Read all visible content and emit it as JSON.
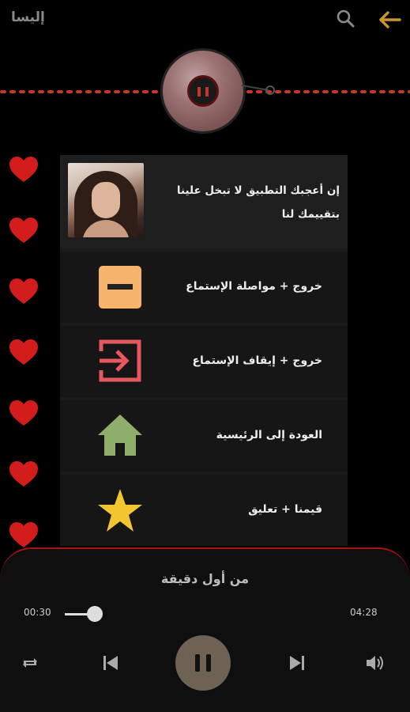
{
  "header": {
    "title": "إليسا",
    "search_icon": "search-icon",
    "back_icon": "back-arrow-icon",
    "accent": "#c9952c"
  },
  "dialog": {
    "rate_message": "إن أعجبك التطبيق لا تبخل علينا بتقييمك لنا",
    "items": [
      {
        "label": "خروج + مواصلة الإستماع",
        "icon": "minus-box-icon",
        "color": "#f5b36b"
      },
      {
        "label": "خروج + إيقاف الإستماع",
        "icon": "exit-icon",
        "color": "#e8575e"
      },
      {
        "label": "العودة إلى الرئيسية",
        "icon": "home-icon",
        "color": "#8fae6b"
      },
      {
        "label": "قيمنا + تعليق",
        "icon": "star-icon",
        "color": "#f2c531"
      }
    ]
  },
  "player": {
    "song_title": "من أول دقيقة",
    "current_time": "00:30",
    "total_time": "04:28",
    "progress": 0.1
  },
  "colors": {
    "heart": "#d31c1c",
    "player_border": "#b01010"
  }
}
